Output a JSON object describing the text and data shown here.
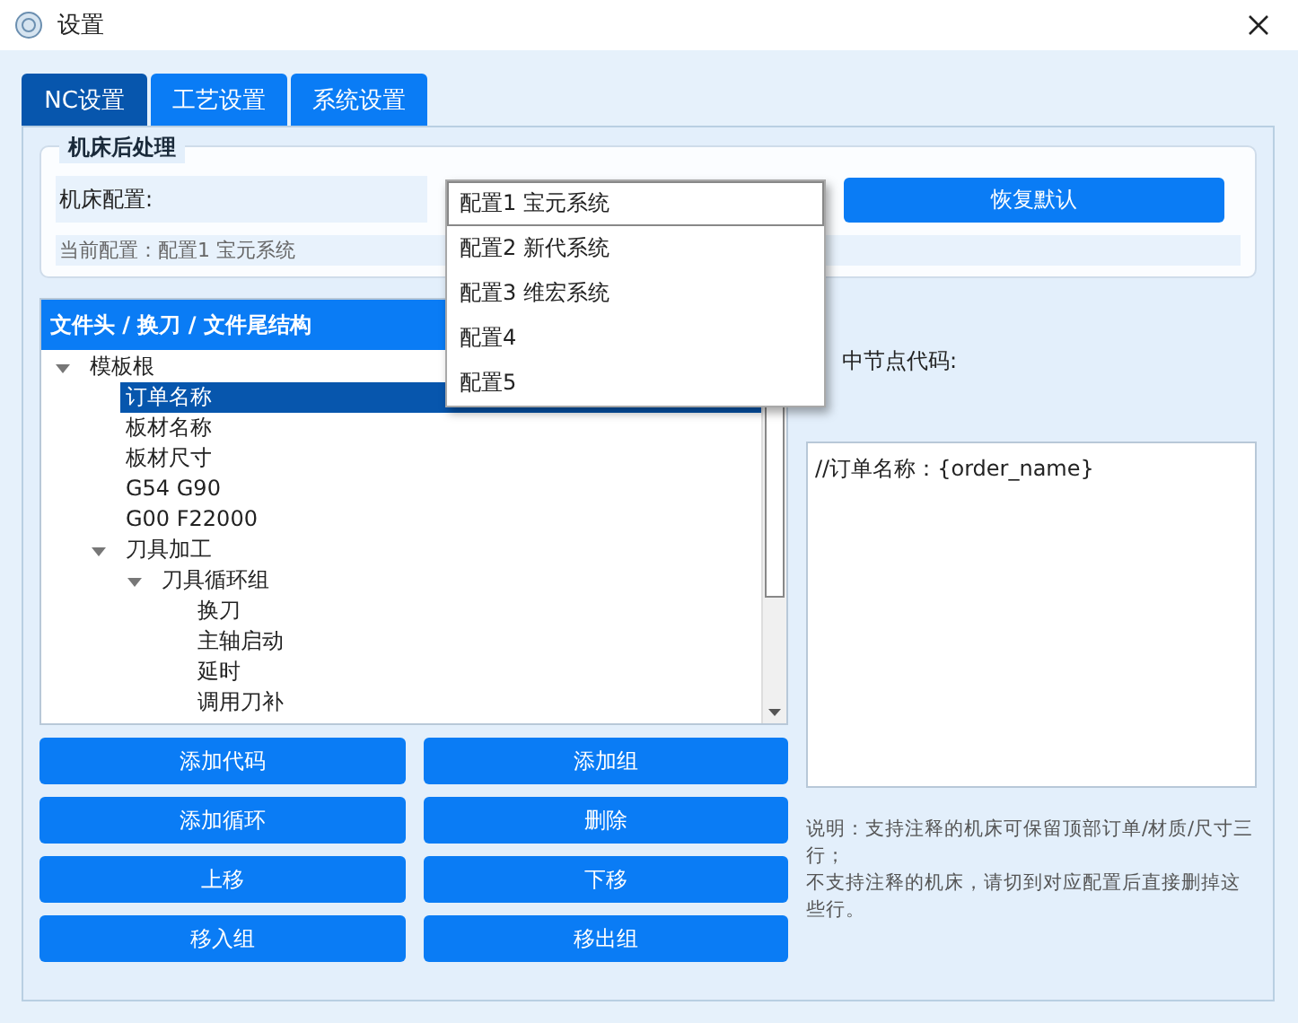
{
  "window": {
    "title": "设置"
  },
  "tabs": [
    {
      "label": "NC设置",
      "selected": true
    },
    {
      "label": "工艺设置",
      "selected": false
    },
    {
      "label": "系统设置",
      "selected": false
    }
  ],
  "machine_group": {
    "title": "机床后处理",
    "config_label": "机床配置:",
    "restore_button": "恢复默认",
    "current_config": "当前配置：配置1 宝元系统",
    "dropdown_options": [
      {
        "label": "配置1 宝元系统",
        "selected": true
      },
      {
        "label": "配置2 新代系统",
        "selected": false
      },
      {
        "label": "配置3 维宏系统",
        "selected": false
      },
      {
        "label": "配置4",
        "selected": false
      },
      {
        "label": "配置5",
        "selected": false
      }
    ]
  },
  "tree": {
    "header": "文件头 / 换刀 / 文件尾结构",
    "items": [
      {
        "label": "模板根",
        "expanded": true,
        "selected": false,
        "children": [
          {
            "label": "订单名称",
            "selected": true
          },
          {
            "label": "板材名称",
            "selected": false
          },
          {
            "label": "板材尺寸",
            "selected": false
          },
          {
            "label": "G54 G90",
            "selected": false
          },
          {
            "label": "G00 F22000",
            "selected": false
          },
          {
            "label": "刀具加工",
            "expanded": true,
            "selected": false,
            "children": [
              {
                "label": "刀具循环组",
                "expanded": true,
                "selected": false,
                "children": [
                  {
                    "label": "换刀",
                    "selected": false
                  },
                  {
                    "label": "主轴启动",
                    "selected": false
                  },
                  {
                    "label": "延时",
                    "selected": false
                  },
                  {
                    "label": "调用刀补",
                    "selected": false
                  }
                ]
              }
            ]
          }
        ]
      }
    ]
  },
  "buttons": [
    "添加代码",
    "添加组",
    "添加循环",
    "删除",
    "上移",
    "下移",
    "移入组",
    "移出组"
  ],
  "code_label": "中节点代码:",
  "code_value": "//订单名称：{order_name}",
  "note": [
    "说明：支持注释的机床可保留顶部订单/材质/尺寸三行；",
    "不支持注释的机床，请切到对应配置后直接删掉这些行。"
  ]
}
